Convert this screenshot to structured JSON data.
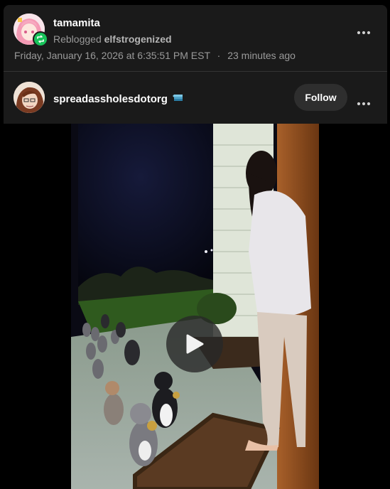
{
  "reblog": {
    "username": "tamamita",
    "reblogged_label": "Reblogged",
    "reblogged_from": "elfstrogenized",
    "timestamp": "Friday, January 16, 2026 at 6:35:51 PM EST",
    "separator": "·",
    "relative_time": "23 minutes ago"
  },
  "post": {
    "username": "spreadassholesdotorg",
    "follow_label": "Follow"
  },
  "icons": {
    "more": "more-horizontal-icon",
    "reblog_badge": "reblog-icon",
    "play": "play-icon"
  },
  "colors": {
    "card_bg": "#1a1a1a",
    "reblog_badge": "#18c35a",
    "follow_bg": "#2e2e2e"
  }
}
